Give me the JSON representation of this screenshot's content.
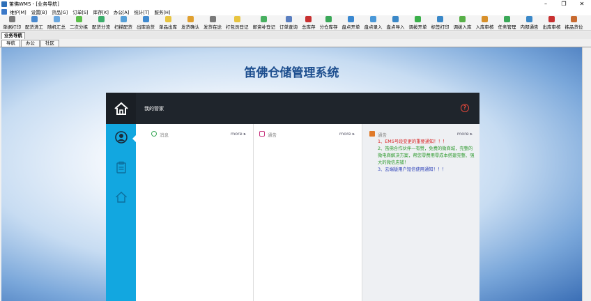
{
  "window": {
    "title": "笛佛WMS - [业务导航]"
  },
  "menu": [
    "维护[M]",
    "设置[B]",
    "货品[G]",
    "订单[S]",
    "库存[K]",
    "办公[A]",
    "统计[T]",
    "服务[H]"
  ],
  "toolbar": [
    {
      "label": "单据打印",
      "color": "#7a7a7a"
    },
    {
      "label": "配货清工",
      "color": "#4a8ad0"
    },
    {
      "label": "随机汇总",
      "color": "#6aa8e0"
    },
    {
      "label": "二次分拣",
      "color": "#5cbf4a"
    },
    {
      "label": "配货分流",
      "color": "#3cae6c"
    },
    {
      "label": "扫描配货",
      "color": "#56a0d8"
    },
    {
      "label": "出库验货",
      "color": "#3f8ad0"
    },
    {
      "label": "单品出库",
      "color": "#e8c440"
    },
    {
      "label": "发货确认",
      "color": "#e0a030"
    },
    {
      "label": "发货在途",
      "color": "#7a7a7a"
    },
    {
      "label": "打包员登记",
      "color": "#e8c440"
    },
    {
      "label": "邮资补登记",
      "color": "#48b060"
    },
    {
      "label": "订单查询",
      "color": "#5a7fc0"
    },
    {
      "label": "总库存",
      "color": "#c83030"
    },
    {
      "label": "分仓库存",
      "color": "#3aa858"
    },
    {
      "label": "盘点开单",
      "color": "#3a88d0"
    },
    {
      "label": "盘点录入",
      "color": "#4a98d8"
    },
    {
      "label": "盘点导入",
      "color": "#3a88c8"
    },
    {
      "label": "调拨开单",
      "color": "#3ab04a"
    },
    {
      "label": "标签打印",
      "color": "#3a88c8"
    },
    {
      "label": "调拨入库",
      "color": "#58b048"
    },
    {
      "label": "入库审核",
      "color": "#d8902a"
    },
    {
      "label": "任务管理",
      "color": "#3aa858"
    },
    {
      "label": "内部通告",
      "color": "#3a88c8"
    },
    {
      "label": "出库审核",
      "color": "#c83030"
    },
    {
      "label": "拣品货位",
      "color": "#c86a30"
    }
  ],
  "tabs_top": [
    "业务导航"
  ],
  "tabs_sub": [
    "导航",
    "办公",
    "社区"
  ],
  "main": {
    "system_title": "笛佛仓储管理系统",
    "panel_title": "我的管家"
  },
  "columns": [
    {
      "title": "消息",
      "more": "more ▸",
      "icon_color": "#3aa858"
    },
    {
      "title": "通告",
      "more": "more ▸",
      "icon_color": "#c83880"
    },
    {
      "title": "通告",
      "more": "more ▸",
      "icon_color": "#e07a2a"
    }
  ],
  "notices": [
    {
      "text": "1、EMS号段变更的重要通知！！！",
      "color": "red"
    },
    {
      "text": "2、笛佛合作伙伴—有赞，免费的微商城，完整的微电商解决方案，帮您零费用零成本搭建完整、强大的微信店铺！",
      "color": "green"
    },
    {
      "text": "3、云端版用户短信使用通知！！！",
      "color": "blue"
    }
  ]
}
